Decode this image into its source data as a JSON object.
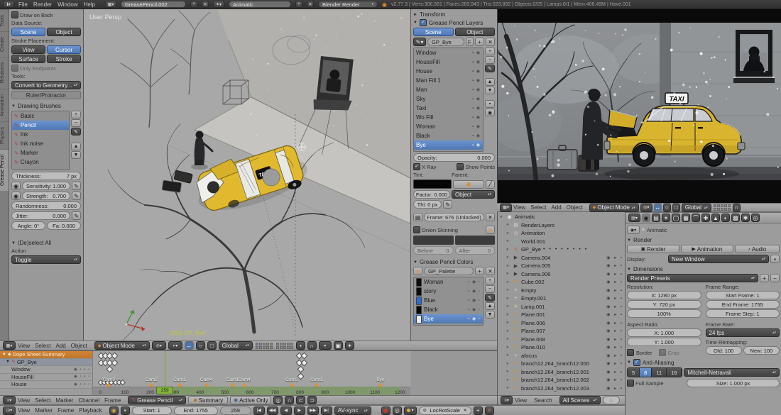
{
  "topbar": {
    "menus": [
      "File",
      "Render",
      "Window",
      "Help"
    ],
    "screen_name": "GreasePencil.002",
    "scene_name": "Animatic",
    "engine": "Blender Render",
    "stats": "v2.77.3 | Verts:306,561 | Faces:283,943 | Tris:523,892 | Objects:0/25 | Lamps:0/1 | Mem:406.49M | Have.001"
  },
  "tool_shelf": {
    "tabs": [
      "Tools",
      "Create",
      "Relations",
      "Animation",
      "Physics",
      "Grease Pencil"
    ],
    "active_tab": "Grease Pencil",
    "draw_on_back": "Draw on Back",
    "data_source_label": "Data Source:",
    "scene_btn": "Scene",
    "object_btn": "Object",
    "stroke_placement_label": "Stroke Placement:",
    "view_btn": "View",
    "cursor_btn": "Cursor",
    "surface_btn": "Surface",
    "stroke_btn": "Stroke",
    "only_endpoints": "Only Endpoints",
    "tools_label": "Tools:",
    "convert_btn": "Convert to Geometry...",
    "ruler_btn": "Ruler/Protractor",
    "brushes_title": "Drawing Brushes",
    "brushes": [
      "Basic",
      "Pencil",
      "Ink",
      "Ink noise",
      "Marker",
      "Crayon"
    ],
    "active_brush": "Pencil",
    "thickness_label": "Thickness:",
    "thickness_value": "7 px",
    "sensitivity_label": "Sensitivity:",
    "sensitivity_value": "1.000",
    "strength_label": "Strength:",
    "strength_value": "0.700",
    "randomness_label": "Randomness:",
    "randomness_value": "0.000",
    "jitter_label": "Jitter:",
    "jitter_value": "0.000",
    "angle_label": "Angle: 0°",
    "fa_label": "Fa: 0.000",
    "deselect_title": "(De)select All",
    "action_label": "Action",
    "action_value": "Toggle"
  },
  "viewport": {
    "view_label": "User Persp",
    "frame_info": "(259) GP_Bye",
    "header_menus": [
      "View",
      "Select",
      "Add",
      "Object"
    ],
    "mode": "Object Mode",
    "orientation": "Global"
  },
  "scene": {
    "taxi_sign": "TAXI"
  },
  "npanel": {
    "transform_title": "Transform",
    "layers_title": "Grease Pencil Layers",
    "scene_btn": "Scene",
    "object_btn": "Object",
    "datablock": "GP_Bye",
    "fake_user": "F",
    "layers": [
      "Window",
      "HouseFill",
      "House",
      "Man Fill 1",
      "Man",
      "Sky",
      "Taxi",
      "Wo Fill",
      "Woman",
      "Black",
      "Bye"
    ],
    "active_layer": "Bye",
    "opacity_label": "Opacity:",
    "opacity_value": "0.000",
    "xray": "X Ray",
    "show_points": "Show Points",
    "tint_label": "Tint:",
    "parent_label": "Parent:",
    "factor": "Factor: 0.000",
    "stroke_thickness": "Thi: 0 px",
    "parent_value": "Object",
    "frame_lock": "Frame: 676 (Unlocked)",
    "onion": "Onion Skinning",
    "before": "Before",
    "before_value": "0",
    "after": "After",
    "after_value": "0",
    "colors_title": "Grease Pencil Colors",
    "palette_name": "GP_Palette",
    "colors": [
      {
        "name": "Woman",
        "hex": "#0b0b0b"
      },
      {
        "name": "story",
        "hex": "#0b0b0b"
      },
      {
        "name": "Blue",
        "hex": "#2e6bd4"
      },
      {
        "name": "Black",
        "hex": "#050505"
      },
      {
        "name": "Bye",
        "hex": "#e8e8e5"
      }
    ],
    "active_color": "Bye"
  },
  "outliner": {
    "view": "View",
    "search": "Search",
    "scenes_filter": "All Scenes",
    "items": [
      {
        "name": "Animatic",
        "icon": "scene",
        "indent": 0,
        "rest": false
      },
      {
        "name": "RenderLayers",
        "icon": "layers",
        "indent": 1,
        "rest": false
      },
      {
        "name": "Animation",
        "icon": "anim",
        "indent": 1,
        "rest": false
      },
      {
        "name": "World.001",
        "icon": "world",
        "indent": 1,
        "rest": false
      },
      {
        "name": "GP_Bye",
        "icon": "gp",
        "indent": 1,
        "rest": false,
        "dots": true
      },
      {
        "name": "Camera.004",
        "icon": "camera",
        "indent": 1,
        "rest": true
      },
      {
        "name": "Camera.005",
        "icon": "camera",
        "indent": 1,
        "rest": true
      },
      {
        "name": "Camera.006",
        "icon": "camera",
        "indent": 1,
        "rest": true
      },
      {
        "name": "Cube.002",
        "icon": "mesh",
        "indent": 1,
        "rest": true
      },
      {
        "name": "Empty",
        "icon": "empty",
        "indent": 1,
        "rest": true
      },
      {
        "name": "Empty.001",
        "icon": "empty",
        "indent": 1,
        "rest": true
      },
      {
        "name": "Lamp.001",
        "icon": "lamp",
        "indent": 1,
        "rest": true
      },
      {
        "name": "Plane.001",
        "icon": "mesh",
        "indent": 1,
        "rest": true
      },
      {
        "name": "Plane.006",
        "icon": "mesh",
        "indent": 1,
        "rest": true
      },
      {
        "name": "Plane.007",
        "icon": "mesh",
        "indent": 1,
        "rest": true
      },
      {
        "name": "Plane.008",
        "icon": "mesh",
        "indent": 1,
        "rest": true
      },
      {
        "name": "Plane.010",
        "icon": "mesh",
        "indent": 1,
        "rest": true
      },
      {
        "name": "afocus",
        "icon": "empty",
        "indent": 1,
        "rest": true
      },
      {
        "name": "branch12.264_branch12.000",
        "icon": "mesh",
        "indent": 1,
        "rest": true
      },
      {
        "name": "branch12.264_branch12.001",
        "icon": "mesh",
        "indent": 1,
        "rest": true
      },
      {
        "name": "branch12.264_branch12.002",
        "icon": "mesh",
        "indent": 1,
        "rest": true
      },
      {
        "name": "branch12.264_branch12.003",
        "icon": "mesh",
        "indent": 1,
        "rest": true
      }
    ]
  },
  "properties": {
    "breadcrumb": "Animatic",
    "render_title": "Render",
    "render_btn": "Render",
    "animation_btn": "Animation",
    "audio_btn": "Audio",
    "display_label": "Display:",
    "display_value": "New Window",
    "dimensions_title": "Dimensions",
    "presets": "Render Presets",
    "resolution_label": "Resolution:",
    "res_x": "X: 1280 px",
    "res_y": "Y: 720 px",
    "res_pct": "100%",
    "frame_range_label": "Frame Range:",
    "start_frame": "Start Frame: 1",
    "end_frame": "End Frame: 1755",
    "frame_step": "Frame Step: 1",
    "aspect_label": "Aspect Ratio:",
    "aspect_x": "X: 1.000",
    "aspect_y": "Y: 1.000",
    "border": "Border",
    "crop": "Crop",
    "frame_rate_label": "Frame Rate:",
    "fps": "24 fps",
    "remap_label": "Time Remapping:",
    "old_value": "Old: 100",
    "new_value": "New: 100",
    "aa_title": "Anti-Aliasing",
    "samples": [
      "5",
      "8",
      "11",
      "16"
    ],
    "active_sample": "8",
    "filter": "Mitchell-Netravali",
    "full_sample": "Full Sample",
    "size": "Size: 1.000 px"
  },
  "dopesheet": {
    "summary_label": "Dope Sheet Summary",
    "gp_label": "GP_Bye",
    "channels": [
      "Window",
      "HouseFill",
      "House"
    ],
    "ruler": [
      0,
      100,
      200,
      300,
      400,
      500,
      600,
      700,
      800,
      900,
      1000,
      1100,
      1200
    ],
    "markers": [
      {
        "label": "Cam3",
        "frame": 35
      },
      {
        "label": "Cam2",
        "frame": 205
      },
      {
        "label": "Cam1",
        "frame": 318
      },
      {
        "label": "Cam4",
        "frame": 425
      },
      {
        "label": "Cam1",
        "frame": 530
      },
      {
        "label": "Cam4",
        "frame": 577
      },
      {
        "label": "Cam2",
        "frame": 767
      },
      {
        "label": "Cam1",
        "frame": 866
      },
      {
        "label": "Bye",
        "frame": 1122
      }
    ],
    "current_frame": "259",
    "current_frame_num": 259,
    "preview_range": [
      290,
      1200
    ],
    "keys": {
      "summary": [
        0,
        18,
        36,
        55,
        795,
        815
      ],
      "gp": [
        0,
        18,
        36,
        55,
        795,
        815
      ],
      "window": [
        36,
        800
      ],
      "housefill": [
        800
      ],
      "house": [
        0,
        15,
        30,
        45,
        60,
        75,
        90
      ]
    },
    "menus": [
      "View",
      "Select",
      "Marker",
      "Channel",
      "Frame"
    ],
    "mode": "Grease Pencil",
    "summary_btn": "Summary",
    "active_only": "Active Only"
  },
  "timeline": {
    "menus": [
      "View",
      "Marker",
      "Frame",
      "Playback"
    ],
    "start": "Start: 1",
    "end": "End: 1755",
    "current": "259",
    "avsync": "AV-sync",
    "keying_set": "LocRotScale"
  }
}
